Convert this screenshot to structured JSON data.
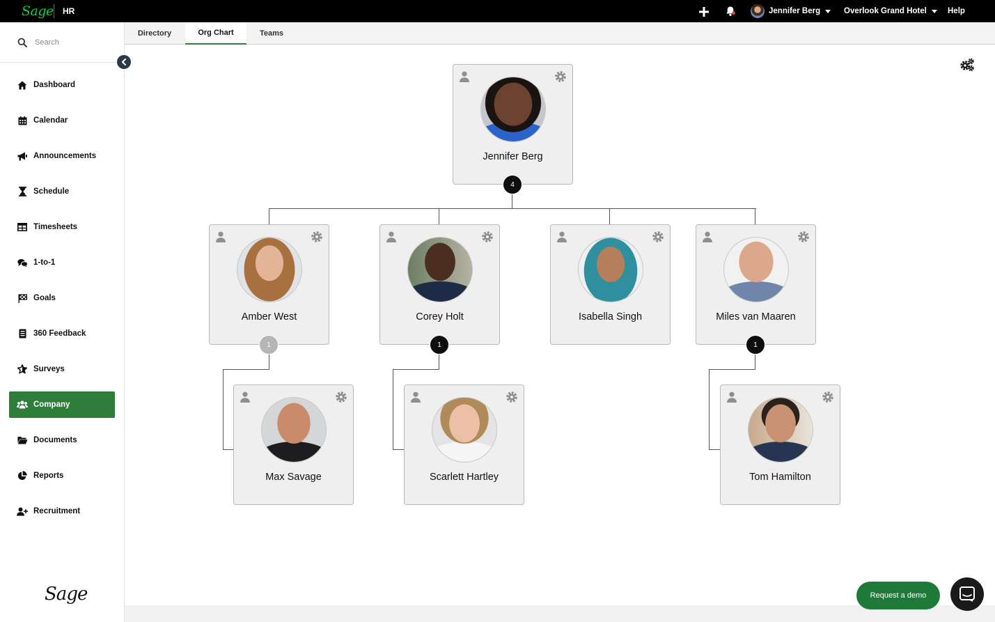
{
  "topbar": {
    "logo": "Sage",
    "app_label": "HR",
    "user_name": "Jennifer Berg",
    "company_name": "Overlook Grand Hotel",
    "help_label": "Help",
    "plus_icon": "plus-icon",
    "bell_icon": "bell-icon"
  },
  "sidebar": {
    "search_placeholder": "Search",
    "items": [
      {
        "label": "Dashboard",
        "icon": "home-icon"
      },
      {
        "label": "Calendar",
        "icon": "calendar-icon"
      },
      {
        "label": "Announcements",
        "icon": "megaphone-icon"
      },
      {
        "label": "Schedule",
        "icon": "hourglass-icon"
      },
      {
        "label": "Timesheets",
        "icon": "table-icon"
      },
      {
        "label": "1-to-1",
        "icon": "chat-bubbles-icon"
      },
      {
        "label": "Goals",
        "icon": "flag-icon"
      },
      {
        "label": "360 Feedback",
        "icon": "clipboard-icon"
      },
      {
        "label": "Surveys",
        "icon": "star-icon"
      },
      {
        "label": "Company",
        "icon": "users-icon",
        "active": true
      },
      {
        "label": "Documents",
        "icon": "folder-icon"
      },
      {
        "label": "Reports",
        "icon": "pie-chart-icon"
      },
      {
        "label": "Recruitment",
        "icon": "user-plus-icon"
      }
    ],
    "footer_logo": "Sage"
  },
  "tabs": [
    {
      "label": "Directory"
    },
    {
      "label": "Org Chart",
      "active": true
    },
    {
      "label": "Teams"
    }
  ],
  "org_chart": {
    "root": {
      "name": "Jennifer Berg",
      "reports": "4"
    },
    "level1": [
      {
        "name": "Amber West",
        "reports": "1",
        "badge_muted": true
      },
      {
        "name": "Corey Holt",
        "reports": "1"
      },
      {
        "name": "Isabella Singh"
      },
      {
        "name": "Miles van Maaren",
        "reports": "1"
      }
    ],
    "level2": [
      {
        "name": "Max Savage"
      },
      {
        "name": "Scarlett Hartley"
      },
      {
        "name": "Tom Hamilton"
      }
    ]
  },
  "actions": {
    "demo_label": "Request a demo"
  },
  "colors": {
    "brand_green": "#00d639",
    "active_nav": "#2e7d3a",
    "demo_button": "#1f7a3a"
  }
}
